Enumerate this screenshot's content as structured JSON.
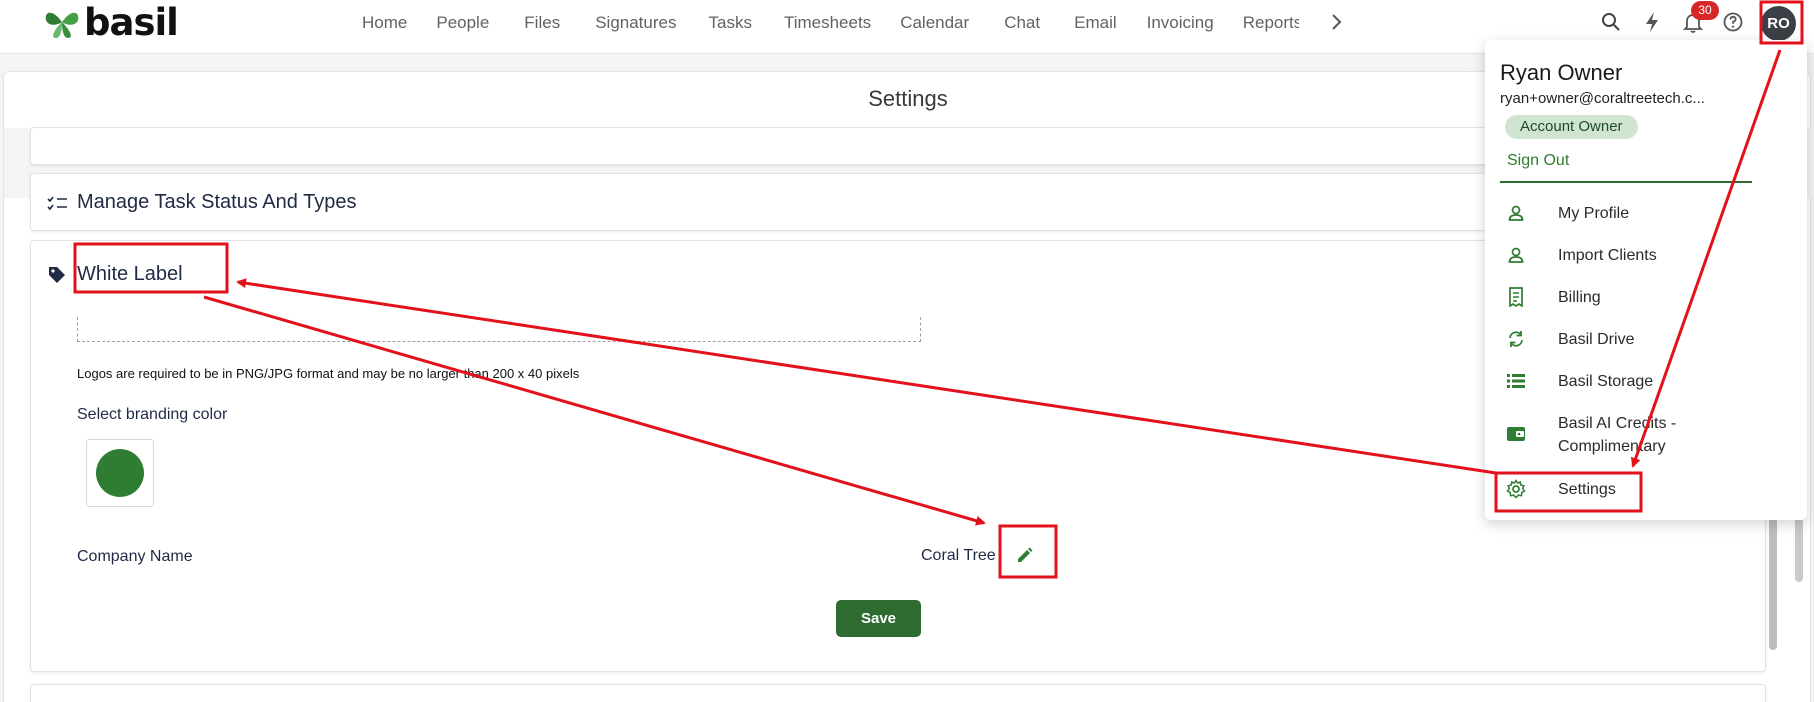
{
  "app": {
    "logo_text": "basil"
  },
  "nav": {
    "items": [
      "Home",
      "People",
      "Files",
      "Signatures",
      "Tasks",
      "Timesheets",
      "Calendar",
      "Chat",
      "Email",
      "Invoicing",
      "Reports"
    ]
  },
  "header": {
    "notification_count": "30",
    "avatar_initials": "RO"
  },
  "settings": {
    "title": "Settings",
    "task_panel_title": "Manage Task Status And Types",
    "white_label": {
      "title": "White Label",
      "logo_hint": "Logos are required to be in PNG/JPG format and may be no larger than 200 x 40 pixels",
      "branding_label": "Select branding color",
      "branding_color": "#2e7d32",
      "company_label": "Company Name",
      "company_value": "Coral Tree",
      "save_label": "Save"
    }
  },
  "user_menu": {
    "name": "Ryan Owner",
    "email": "ryan+owner@coraltreetech.c...",
    "role": "Account Owner",
    "sign_out": "Sign Out",
    "items": [
      {
        "label": "My Profile",
        "icon": "person-icon"
      },
      {
        "label": "Import Clients",
        "icon": "person-icon"
      },
      {
        "label": "Billing",
        "icon": "receipt-icon"
      },
      {
        "label": "Basil Drive",
        "icon": "sync-icon"
      },
      {
        "label": "Basil Storage",
        "icon": "list-icon"
      },
      {
        "label": "Basil AI Credits - Complimentary",
        "icon": "wallet-icon"
      },
      {
        "label": "Settings",
        "icon": "gear-icon"
      }
    ]
  },
  "colors": {
    "brand_green": "#2e6b30",
    "annotation_red": "#e3111b"
  }
}
